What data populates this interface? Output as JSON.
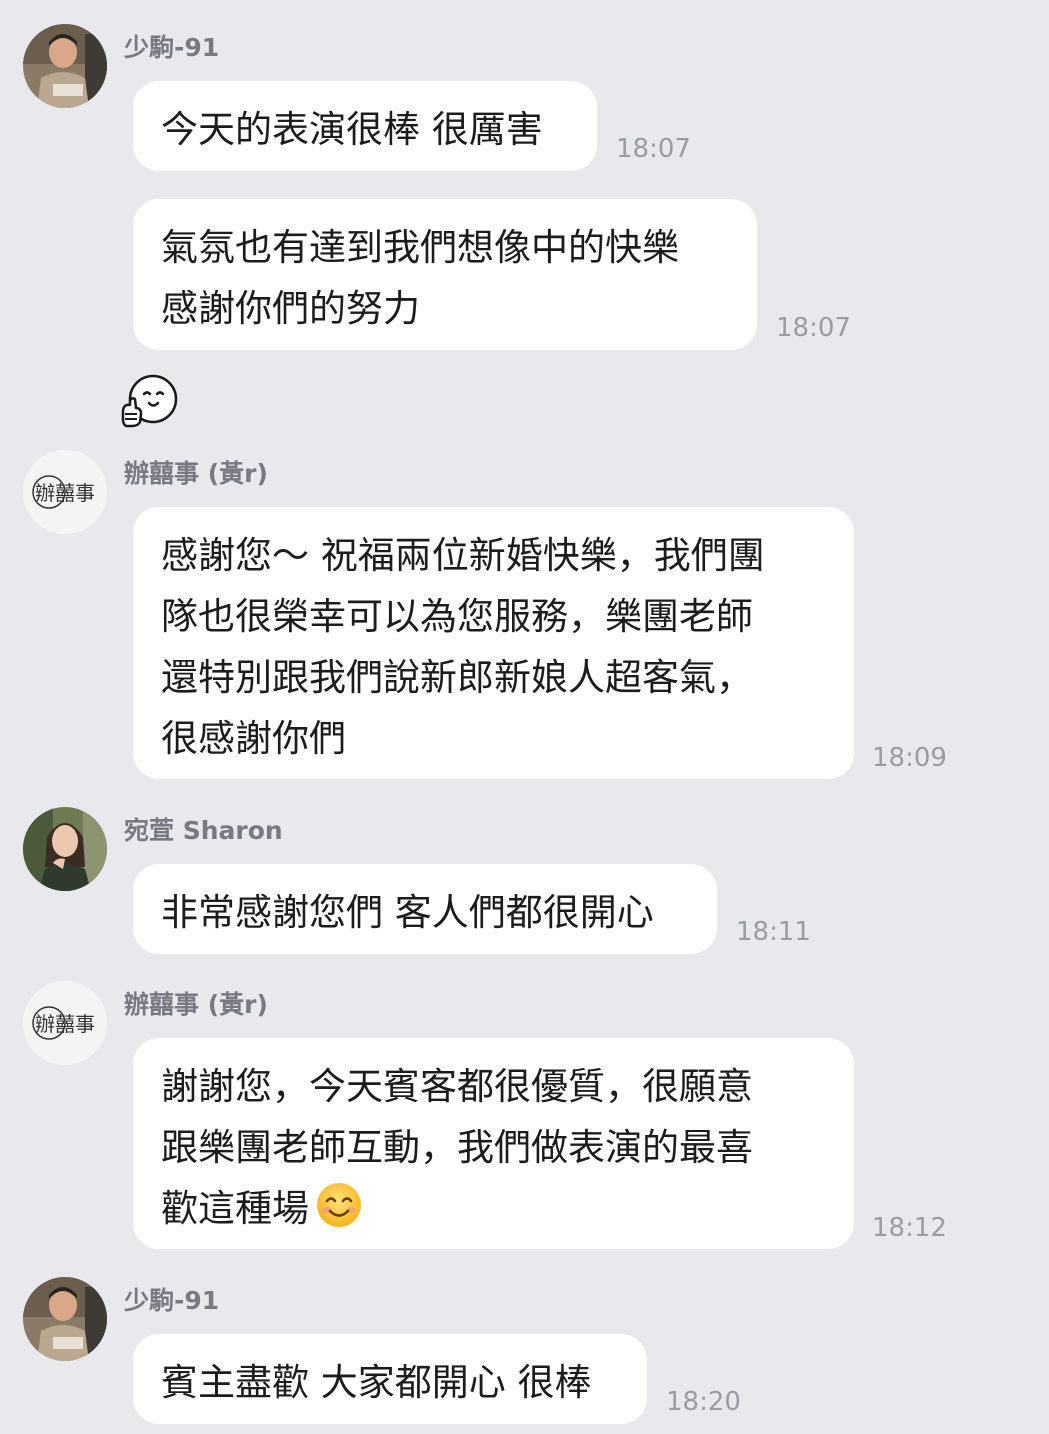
{
  "messages": [
    {
      "sender": "少駒-91",
      "bubbles": [
        {
          "lines": [
            "今天的表演很棒 很厲害"
          ],
          "time": "18:07"
        },
        {
          "lines": [
            "氣氛也有達到我們想像中的快樂",
            "感謝你們的努力"
          ],
          "time": "18:07"
        }
      ],
      "sticker": "thumbs-up-face-sticker"
    },
    {
      "sender": "辦囍事 (黃r)",
      "bubbles": [
        {
          "lines": [
            "感謝您～ 祝福兩位新婚快樂，我們團",
            "隊也很榮幸可以為您服務，樂團老師",
            "還特別跟我們說新郎新娘人超客氣，",
            "很感謝你們"
          ],
          "time": "18:09"
        }
      ]
    },
    {
      "sender": "宛萓  Sharon",
      "bubbles": [
        {
          "lines": [
            "非常感謝您們 客人們都很開心"
          ],
          "time": "18:11"
        }
      ]
    },
    {
      "sender": "辦囍事 (黃r)",
      "bubbles": [
        {
          "lines": [
            "謝謝您，今天賓客都很優質，很願意",
            "跟樂團老師互動，我們做表演的最喜",
            "歡這種場"
          ],
          "emoji": "smiling-face-emoji",
          "time": "18:12"
        }
      ]
    },
    {
      "sender": "少駒-91",
      "bubbles": [
        {
          "lines": [
            "賓主盡歡 大家都開心 很棒"
          ],
          "time": "18:20"
        }
      ]
    }
  ],
  "logo_text": "辦囍事"
}
